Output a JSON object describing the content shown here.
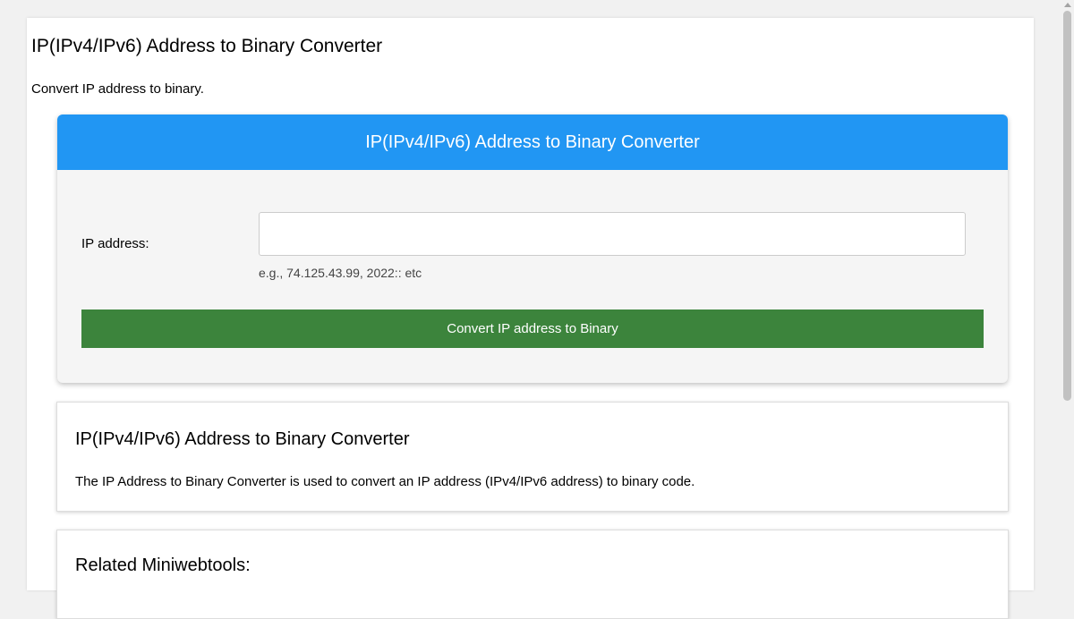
{
  "page": {
    "title": "IP(IPv4/IPv6) Address to Binary Converter",
    "description": "Convert IP address to binary."
  },
  "tool": {
    "header": "IP(IPv4/IPv6) Address to Binary Converter",
    "ip_label": "IP address:",
    "ip_value": "",
    "ip_hint": "e.g., 74.125.43.99, 2022:: etc",
    "convert_label": "Convert IP address to Binary"
  },
  "info": {
    "title": "IP(IPv4/IPv6) Address to Binary Converter",
    "text": "The IP Address to Binary Converter is used to convert an IP address (IPv4/IPv6 address) to binary code."
  },
  "related": {
    "title": "Related Miniwebtools:"
  },
  "colors": {
    "header_blue": "#2196f3",
    "button_green": "#3c843c"
  }
}
